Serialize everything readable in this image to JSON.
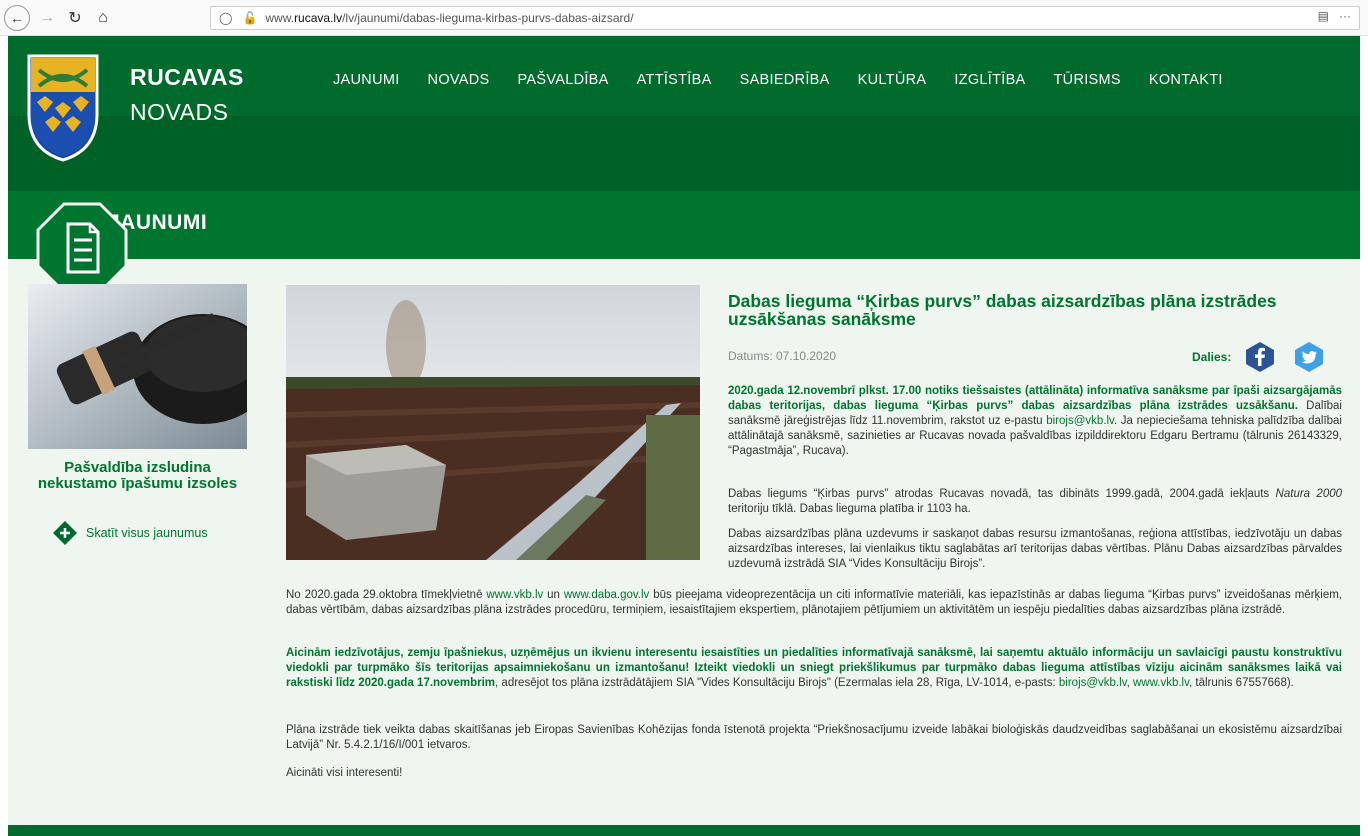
{
  "browser": {
    "url_prefix": "www.",
    "url_host": "rucava.lv",
    "url_path": "/lv/jaunumi/dabas-lieguma-kirbas-purvs-dabas-aizsard/",
    "more_label": "···"
  },
  "brand": {
    "line1": "RUCAVAS",
    "line2": "NOVADS"
  },
  "nav": [
    "JAUNUMI",
    "NOVADS",
    "PAŠVALDĪBA",
    "ATTĪSTĪBA",
    "SABIEDRĪBA",
    "KULTŪRA",
    "IZGLĪTĪBA",
    "TŪRISMS",
    "KONTAKTI"
  ],
  "section": {
    "title": "JAUNUMI"
  },
  "sidebar": {
    "news_title": "Pašvaldība izsludina nekustamo īpašumu izsoles",
    "all_news_link": "Skatīt visus jaunumus"
  },
  "article": {
    "title": "Dabas lieguma “Ķirbas purvs” dabas aizsardzības plāna izstrādes uzsākšanas sanāksme",
    "date": "Datums: 07.10.2020",
    "share_label": "Dalies:",
    "p1_bold": "2020.gada 12.novembrī plkst. 17.00 notiks tiešsaistes (attālināta) informatīva sanāksme par īpaši aizsargājamās dabas teritorijas, dabas lieguma “Ķirbas purvs” dabas aizsardzības plāna izstrādes uzsākšanu.",
    "p1_text": " Dalībai sanāksmē jāreģistrējas līdz 11.novembrim, rakstot uz e-pastu ",
    "p1_email": "birojs@vkb.lv",
    "p1_text2": ". Ja nepieciešama tehniska palīdzība dalībai attālinātajā sanāksmē, sazinieties ar Rucavas novada pašvaldības izpilddirektoru Edgaru Bertramu (tālrunis 26143329, “Pagastmāja”, Rucava).",
    "p2_text": "Dabas liegums “Ķirbas purvs” atrodas Rucavas novadā, tas dibināts 1999.gadā, 2004.gadā iekļauts ",
    "p2_italic": "Natura 2000",
    "p2_text2": " teritoriju tīklā. Dabas lieguma platība ir 1103 ha.",
    "p3_text": "Dabas aizsardzības plāna uzdevums ir saskaņot dabas resursu izmantošanas, reģiona attīstības, iedzīvotāju un dabas aizsardzības intereses, lai vienlaikus tiktu saglabātas arī teritorijas dabas vērtības. Plānu Dabas aizsardzības pārvaldes uzdevumā izstrādā SIA “Vides Konsultāciju Birojs”.",
    "p4_text": "No 2020.gada 29.oktobra tīmekļvietnē ",
    "p4_link1": "www.vkb.lv",
    "p4_and": " un ",
    "p4_link2": "www.daba.gov.lv",
    "p4_text2": " būs pieejama videoprezentācija un citi informatīvie materiāli, kas iepazīstinās ar dabas lieguma “Ķirbas purvs” izveidošanas mērķiem, dabas vērtībām, dabas aizsardzības plāna izstrādes procedūru, termiņiem, iesaistītajiem ekspertiem, plānotajiem pētījumiem un aktivitātēm un iespēju piedalīties dabas aizsardzības plāna izstrādē.",
    "p5_bold": "Aicinām iedzīvotājus, zemju īpašniekus, uzņēmējus un ikvienu interesentu iesaistīties un piedalīties informatīvajā sanāksmē, lai saņemtu aktuālo informāciju un savlaicīgi paustu konstruktīvu viedokli par turpmāko šīs teritorijas apsaimniekošanu un izmantošanu! Izteikt viedokli un sniegt priekšlikumus par turpmāko dabas lieguma attīstības vīziju aicinām sanāksmes laikā vai rakstiski līdz 2020.gada 17.novembrim",
    "p5_text": ", adresējot tos plāna izstrādātājiem SIA \"Vides Konsultāciju Birojs\" (Ezermalas iela 28, Rīga, LV-1014, e-pasts: ",
    "p5_email": "birojs@vkb.lv",
    "p5_sep": ", ",
    "p5_link": "www.vkb.lv",
    "p5_text2": ", tālrunis 67557668).",
    "p6_text": "Plāna izstrāde tiek veikta dabas skaitīšanas jeb Eiropas Savienības Kohēzijas fonda īstenotā projekta “Priekšnosacījumu izveide labākai bioloģiskās daudzveidības saglabāšanai un ekosistēmu aizsardzībai Latvijā” Nr. 5.4.2.1/16/I/001 ietvaros.",
    "p7_text": "Aicināti visi interesenti!"
  },
  "colors": {
    "brand_green": "#006b2d",
    "accent_green": "#00752f",
    "content_bg": "#eef6ef"
  },
  "icons": [
    "back-icon",
    "forward-icon",
    "reload-icon",
    "home-icon",
    "shield-icon",
    "insecure-lock-icon",
    "reader-icon",
    "document-icon",
    "plus-icon",
    "facebook-icon",
    "twitter-icon"
  ]
}
